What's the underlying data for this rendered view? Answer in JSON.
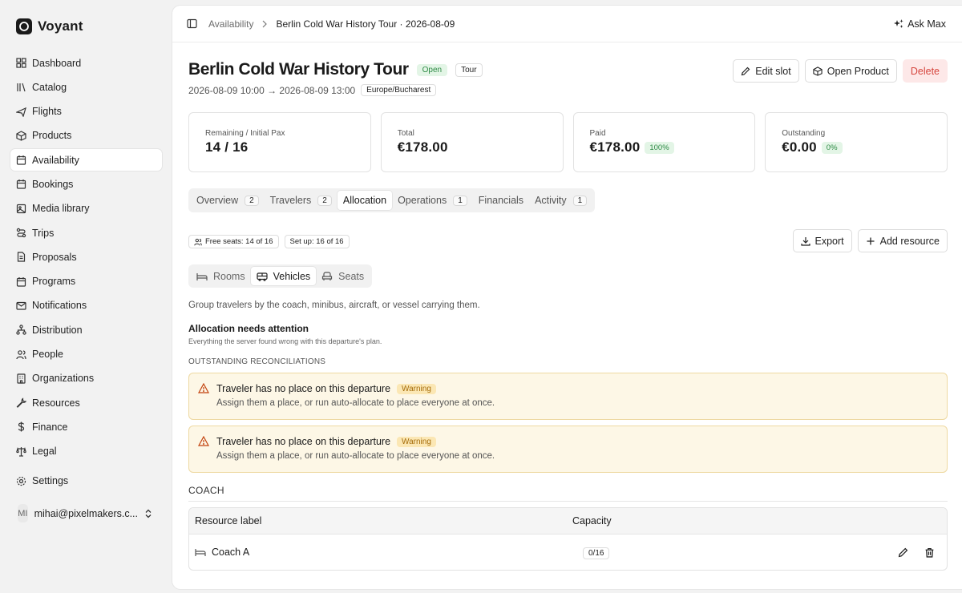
{
  "brand": {
    "name": "Voyant"
  },
  "sidebar": {
    "items": [
      {
        "label": "Dashboard",
        "icon": "dashboard-icon"
      },
      {
        "label": "Catalog",
        "icon": "catalog-icon"
      },
      {
        "label": "Flights",
        "icon": "plane-icon"
      },
      {
        "label": "Products",
        "icon": "package-icon"
      },
      {
        "label": "Availability",
        "icon": "calendar-icon",
        "active": true
      },
      {
        "label": "Bookings",
        "icon": "calendar-icon"
      },
      {
        "label": "Media library",
        "icon": "image-icon"
      },
      {
        "label": "Trips",
        "icon": "route-icon"
      },
      {
        "label": "Proposals",
        "icon": "document-icon"
      },
      {
        "label": "Programs",
        "icon": "calendar-icon"
      },
      {
        "label": "Notifications",
        "icon": "mail-icon"
      },
      {
        "label": "Distribution",
        "icon": "network-icon"
      },
      {
        "label": "People",
        "icon": "users-icon"
      },
      {
        "label": "Organizations",
        "icon": "building-icon"
      },
      {
        "label": "Resources",
        "icon": "wrench-icon"
      },
      {
        "label": "Finance",
        "icon": "dollar-icon"
      },
      {
        "label": "Legal",
        "icon": "scale-icon"
      }
    ],
    "settings": "Settings",
    "user": {
      "initials": "MI",
      "email": "mihai@pixelmakers.c..."
    }
  },
  "topbar": {
    "breadcrumb": [
      "Availability",
      "Berlin Cold War History Tour · 2026-08-09"
    ],
    "ask": "Ask Max"
  },
  "header": {
    "title": "Berlin Cold War History Tour",
    "status": "Open",
    "type": "Tour",
    "dates": "2026-08-09 10:00 → 2026-08-09 13:00",
    "timezone": "Europe/Bucharest",
    "actions": {
      "edit": "Edit slot",
      "open_product": "Open Product",
      "delete": "Delete"
    }
  },
  "stats": [
    {
      "label": "Remaining / Initial Pax",
      "value": "14 / 16",
      "badge": ""
    },
    {
      "label": "Total",
      "value": "€178.00",
      "badge": ""
    },
    {
      "label": "Paid",
      "value": "€178.00",
      "badge": "100%"
    },
    {
      "label": "Outstanding",
      "value": "€0.00",
      "badge": "0%"
    }
  ],
  "tabs": [
    {
      "label": "Overview",
      "count": "2"
    },
    {
      "label": "Travelers",
      "count": "2"
    },
    {
      "label": "Allocation",
      "count": "",
      "active": true
    },
    {
      "label": "Operations",
      "count": "1"
    },
    {
      "label": "Financials",
      "count": ""
    },
    {
      "label": "Activity",
      "count": "1"
    }
  ],
  "allocation": {
    "free_seats": "Free seats: 14 of 16",
    "set_up": "Set up: 16 of 16",
    "export": "Export",
    "add_resource": "Add resource",
    "resource_tabs": [
      {
        "label": "Rooms",
        "icon": "bed-icon"
      },
      {
        "label": "Vehicles",
        "icon": "bus-icon",
        "active": true
      },
      {
        "label": "Seats",
        "icon": "seat-icon"
      }
    ],
    "description": "Group travelers by the coach, minibus, aircraft, or vessel carrying them.",
    "attention_title": "Allocation needs attention",
    "attention_sub": "Everything the server found wrong with this departure's plan.",
    "reconciliations_label": "OUTSTANDING RECONCILIATIONS",
    "warnings": [
      {
        "title": "Traveler has no place on this departure",
        "badge": "Warning",
        "body": "Assign them a place, or run auto-allocate to place everyone at once."
      },
      {
        "title": "Traveler has no place on this departure",
        "badge": "Warning",
        "body": "Assign them a place, or run auto-allocate to place everyone at once."
      }
    ],
    "group_title": "COACH",
    "table": {
      "headers": [
        "Resource label",
        "Capacity"
      ],
      "rows": [
        {
          "label": "Coach A",
          "capacity": "0/16"
        }
      ]
    }
  },
  "colors": {
    "open_green": "#2e8a45",
    "warning_amber": "#a66d0b",
    "danger_red": "#d6453d"
  }
}
